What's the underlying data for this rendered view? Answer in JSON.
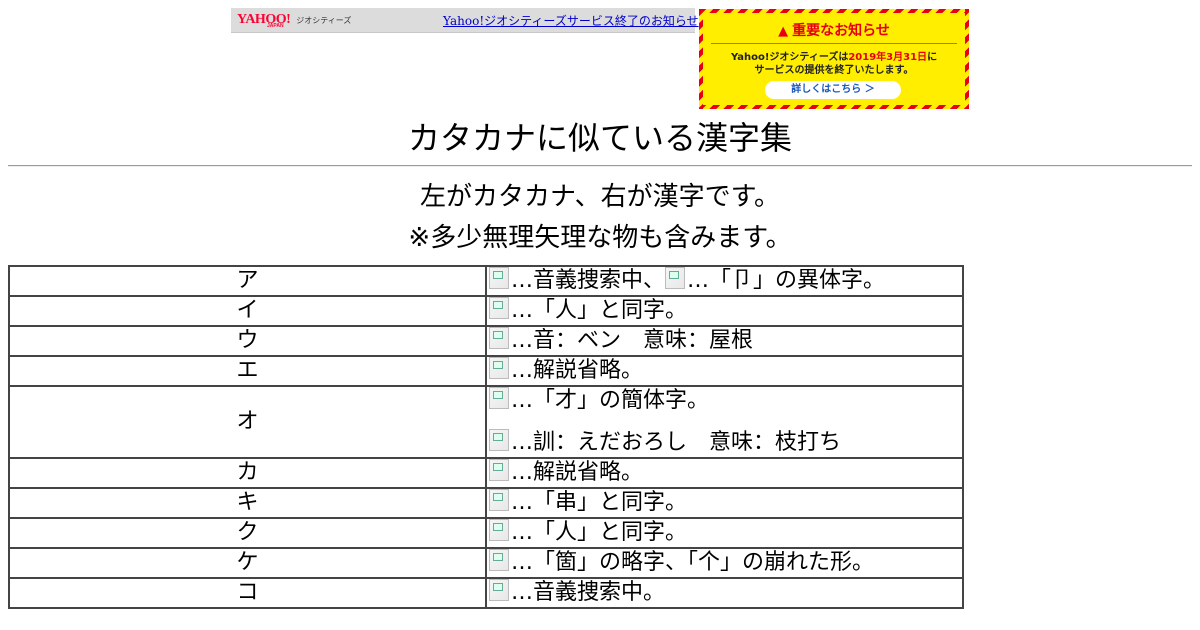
{
  "banner": {
    "logo_text": "YAHOO!",
    "logo_sub": "JAPAN",
    "logo_geo": "ジオシティーズ",
    "link_text": "Yahoo!ジオシティーズサービス終了のお知らせ"
  },
  "notice": {
    "title": "重要なお知らせ",
    "line1_pre": "Yahoo!ジオシティーズは",
    "line1_date": "2019年3月31日",
    "line1_post": "に",
    "line2": "サービスの提供を終了いたします。",
    "button": "詳しくはこちら ＞",
    "colors": {
      "stripe": "#e60012",
      "background": "#ffee00"
    }
  },
  "page": {
    "title": "カタカナに似ている漢字集",
    "subtitle1": "左がカタカナ、右が漢字です。",
    "subtitle2": "※多少無理矢理な物も含みます。"
  },
  "rows": [
    {
      "kana": "ア",
      "p1a": "…音義捜索中、",
      "p1b": "…「卩」の異体字。"
    },
    {
      "kana": "イ",
      "p1a": "…「人」と同字。"
    },
    {
      "kana": "ウ",
      "p1a": "…音：ベン　意味：屋根"
    },
    {
      "kana": "エ",
      "p1a": "…解説省略。"
    },
    {
      "kana": "オ",
      "p1a": "…「才」の簡体字。",
      "p2a": "…訓：えだおろし　意味：枝打ち"
    },
    {
      "kana": "カ",
      "p1a": "…解説省略。"
    },
    {
      "kana": "キ",
      "p1a": "…「串」と同字。"
    },
    {
      "kana": "ク",
      "p1a": "…「人」と同字。"
    },
    {
      "kana": "ケ",
      "p1a": "…「箇」の略字、「个」の崩れた形。"
    },
    {
      "kana": "コ",
      "p1a": "…音義捜索中。"
    }
  ]
}
